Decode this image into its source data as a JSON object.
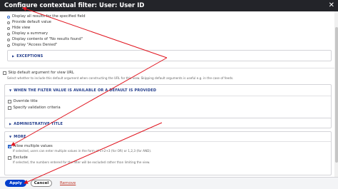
{
  "dialog": {
    "title": "Configure contextual filter: User: User ID",
    "close_glyph": "✕"
  },
  "default_action": {
    "options": [
      {
        "label": "Display all results for the specified field",
        "selected": true
      },
      {
        "label": "Provide default value",
        "selected": false
      },
      {
        "label": "Hide view",
        "selected": false
      },
      {
        "label": "Display a summary",
        "selected": false
      },
      {
        "label": "Display contents of \"No results found\"",
        "selected": false
      },
      {
        "label": "Display \"Access Denied\"",
        "selected": false
      }
    ]
  },
  "exceptions": {
    "label": "EXCEPTIONS"
  },
  "skip_default": {
    "label": "Skip default argument for view URL",
    "description": "Select whether to include this default argument when constructing the URL for this view. Skipping default arguments is useful e.g. in the case of feeds."
  },
  "when_filter": {
    "label": "WHEN THE FILTER VALUE IS AVAILABLE OR A DEFAULT IS PROVIDED",
    "options": [
      {
        "label": "Override title",
        "checked": false
      },
      {
        "label": "Specify validation criteria",
        "checked": false
      }
    ]
  },
  "administrative_title": {
    "label": "ADMINISTRATIVE TITLE"
  },
  "more": {
    "label": "MORE",
    "allow_multiple": {
      "label": "Allow multiple values",
      "checked": true,
      "description": "If selected, users can enter multiple values in the form of 1+2+3 (for OR) or 1,2,3 (for AND)."
    },
    "exclude": {
      "label": "Exclude",
      "checked": false,
      "description": "If selected, the numbers entered for the filter will be excluded rather than limiting the view."
    }
  },
  "buttons": {
    "apply": "Apply",
    "cancel": "Cancel",
    "remove": "Remove"
  },
  "colors": {
    "accent": "#003ecc",
    "titlebar": "#232429",
    "annotation_arrow": "#e0141e",
    "remove": "#c0392b"
  }
}
